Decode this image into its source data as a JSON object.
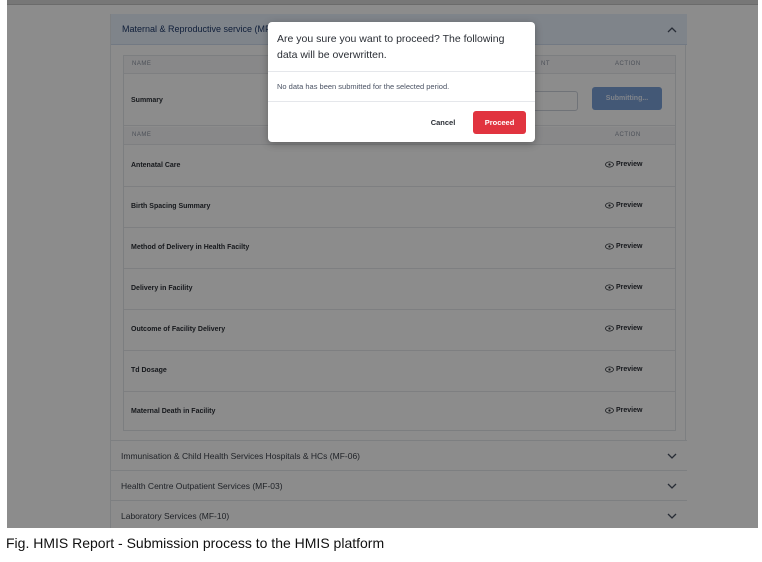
{
  "panel": {
    "title": "Maternal & Reproductive service (MF-0",
    "summary_table": {
      "col_name": "NAME",
      "col_comment_partial": "NT",
      "col_action": "ACTION",
      "row_label": "Summary",
      "submit_button": "Submitting..."
    },
    "forms_table": {
      "col_name": "NAME",
      "col_action": "ACTION",
      "preview_label": "Preview",
      "rows": [
        "Antenatal Care",
        "Birth Spacing Summary",
        "Method of Delivery in Health Facilty",
        "Delivery in Facility",
        "Outcome of Facility Delivery",
        "Td Dosage",
        "Maternal Death in Facility"
      ]
    }
  },
  "accordions": [
    "Immunisation & Child Health Services Hospitals & HCs (MF-06)",
    "Health Centre Outpatient Services (MF-03)",
    "Laboratory Services (MF-10)"
  ],
  "modal": {
    "title": "Are you sure you want to proceed? The following data will be overwritten.",
    "body": "No data has been submitted for the selected period.",
    "cancel_label": "Cancel",
    "proceed_label": "Proceed"
  },
  "caption": "Fig. HMIS Report - Submission process to the HMIS platform",
  "colors": {
    "accent": "#7aa0d8",
    "danger": "#e1343f",
    "header_bg": "#e8f0fb"
  },
  "icons": {
    "collapse": "chevron-up-icon",
    "expand": "chevron-down-icon",
    "preview": "eye-icon"
  }
}
